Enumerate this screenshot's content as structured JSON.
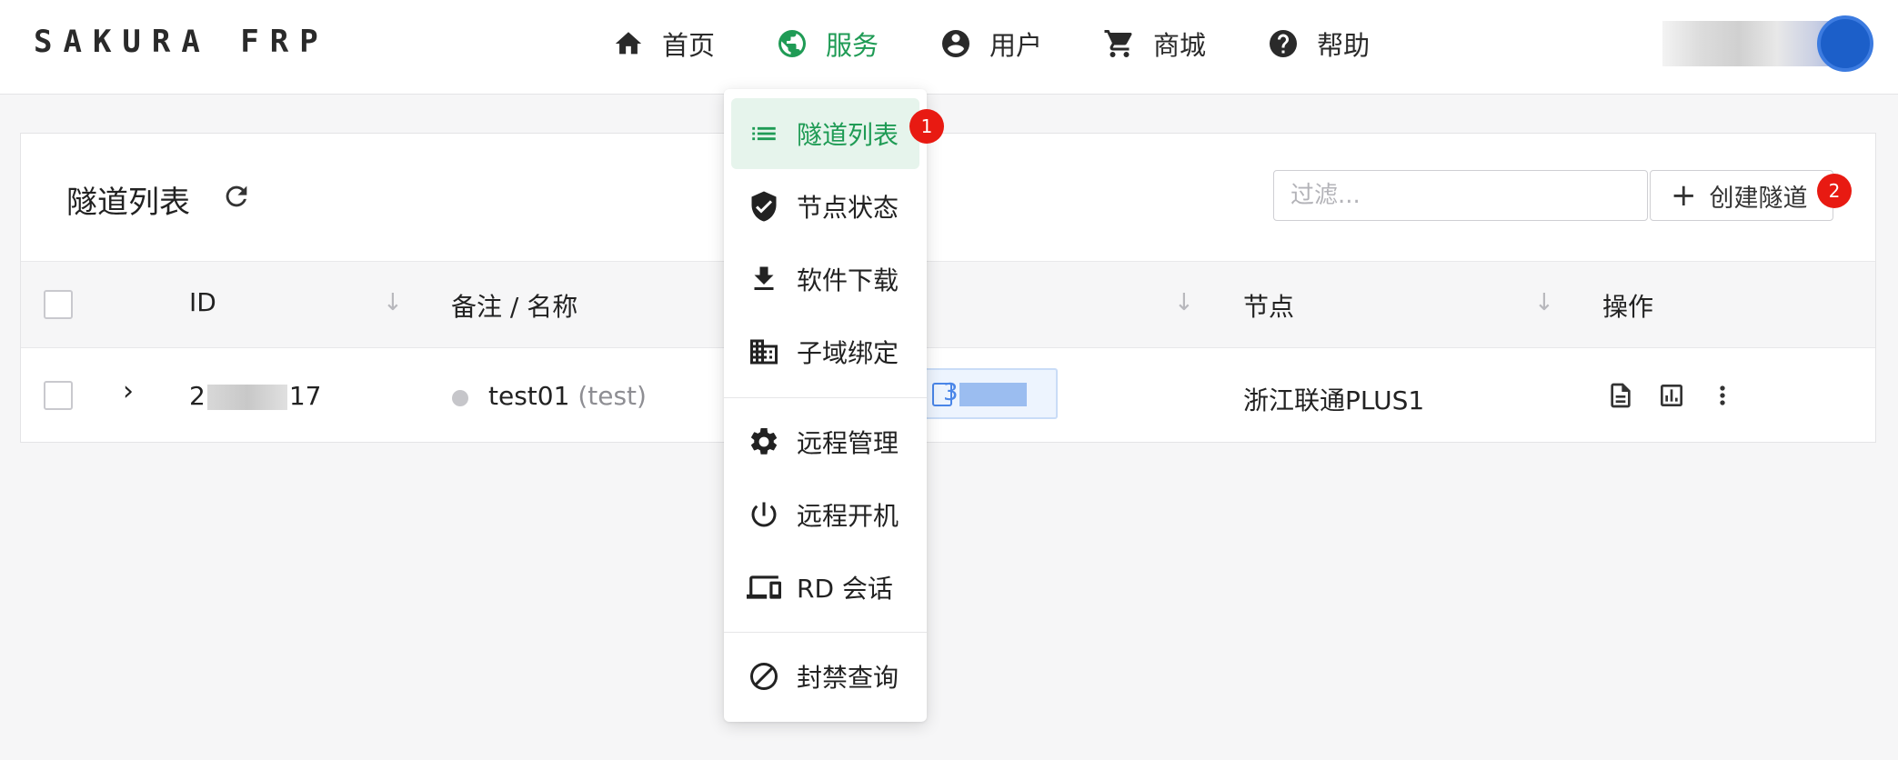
{
  "brand": "SAKURA FRP",
  "nav": [
    {
      "label": "首页",
      "icon": "home-icon"
    },
    {
      "label": "服务",
      "icon": "globe-icon",
      "active": true
    },
    {
      "label": "用户",
      "icon": "account-circle-icon"
    },
    {
      "label": "商城",
      "icon": "cart-icon"
    },
    {
      "label": "帮助",
      "icon": "help-circle-icon"
    }
  ],
  "menu": {
    "items": [
      {
        "label": "隧道列表",
        "icon": "list-icon",
        "active": true,
        "badge": "1"
      },
      {
        "label": "节点状态",
        "icon": "shield-check-icon"
      },
      {
        "label": "软件下载",
        "icon": "download-icon"
      },
      {
        "label": "子域绑定",
        "icon": "domain-icon"
      },
      {
        "label": "远程管理",
        "icon": "gear-icon"
      },
      {
        "label": "远程开机",
        "icon": "power-icon"
      },
      {
        "label": "RD 会话",
        "icon": "devices-icon"
      },
      {
        "label": "封禁查询",
        "icon": "block-icon"
      }
    ]
  },
  "card": {
    "title": "隧道列表",
    "filter_placeholder": "过滤...",
    "create_label": "创建隧道",
    "create_badge": "2"
  },
  "table": {
    "headers": {
      "id": "ID",
      "name": "备注 / 名称",
      "node": "节点",
      "actions": "操作"
    },
    "rows": [
      {
        "id_start": "2",
        "id_end": "17",
        "name": "test01",
        "note": "(test)",
        "addr_start": "3",
        "node": "浙江联通PLUS1"
      }
    ]
  },
  "colors": {
    "accent": "#1f9b55",
    "badge": "#e81a12",
    "highlight": "#e6f4ec"
  }
}
